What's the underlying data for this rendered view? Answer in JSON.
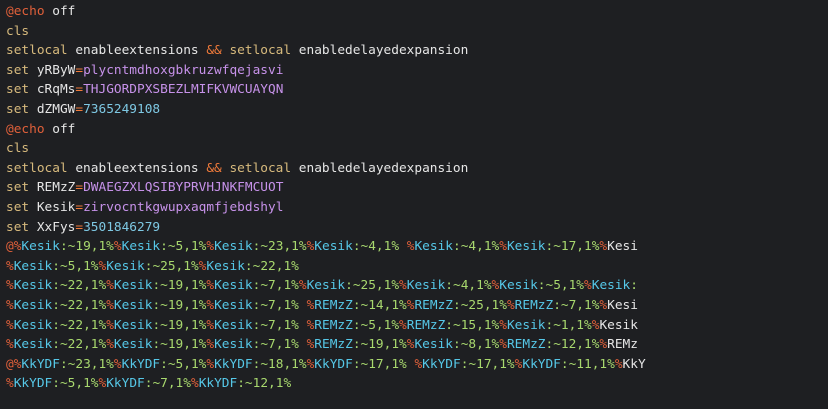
{
  "colors": {
    "background": "#1e1f22",
    "at": "#e0603a",
    "keyword": "#c8c8c8",
    "command": "#d7ba7d",
    "plain": "#e6e6e6",
    "operator": "#f07a3a",
    "value": "#c792ea",
    "string": "#a5d36e",
    "number": "#7ec8e3",
    "percent": "#e0603a",
    "varname": "#56c8e8",
    "substr": "#a8d86e"
  },
  "lines": [
    [
      {
        "t": "@echo",
        "c": "at"
      },
      {
        "t": " off",
        "c": "plain"
      }
    ],
    [
      {
        "t": "cls",
        "c": "command"
      }
    ],
    [
      {
        "t": "setlocal",
        "c": "command"
      },
      {
        "t": " enableextensions ",
        "c": "plain"
      },
      {
        "t": "&&",
        "c": "operator"
      },
      {
        "t": " setlocal",
        "c": "command"
      },
      {
        "t": " enabledelayedexpansion",
        "c": "plain"
      }
    ],
    [
      {
        "t": "set",
        "c": "command"
      },
      {
        "t": " yRByW",
        "c": "plain"
      },
      {
        "t": "=",
        "c": "operator"
      },
      {
        "t": "plycntmdhoxgbkruzwfqejasvi",
        "c": "value"
      }
    ],
    [
      {
        "t": "set",
        "c": "command"
      },
      {
        "t": " cRqMs",
        "c": "plain"
      },
      {
        "t": "=",
        "c": "operator"
      },
      {
        "t": "THJGORDPXSBEZLMIFKVWCUAYQN",
        "c": "value"
      }
    ],
    [
      {
        "t": "set",
        "c": "command"
      },
      {
        "t": " dZMGW",
        "c": "plain"
      },
      {
        "t": "=",
        "c": "operator"
      },
      {
        "t": "7365249108",
        "c": "number"
      }
    ],
    [
      {
        "t": "@echo",
        "c": "at"
      },
      {
        "t": " off",
        "c": "plain"
      }
    ],
    [
      {
        "t": "cls",
        "c": "command"
      }
    ],
    [
      {
        "t": "setlocal",
        "c": "command"
      },
      {
        "t": " enableextensions ",
        "c": "plain"
      },
      {
        "t": "&&",
        "c": "operator"
      },
      {
        "t": " setlocal",
        "c": "command"
      },
      {
        "t": " enabledelayedexpansion",
        "c": "plain"
      }
    ],
    [
      {
        "t": "set",
        "c": "command"
      },
      {
        "t": " REMzZ",
        "c": "plain"
      },
      {
        "t": "=",
        "c": "operator"
      },
      {
        "t": "DWAEGZXLQSIBYPRVHJNKFMCUOT",
        "c": "value"
      }
    ],
    [
      {
        "t": "set",
        "c": "command"
      },
      {
        "t": " Kesik",
        "c": "plain"
      },
      {
        "t": "=",
        "c": "operator"
      },
      {
        "t": "zirvocntkgwupxaqmfjebdshyl",
        "c": "value"
      }
    ],
    [
      {
        "t": "set",
        "c": "command"
      },
      {
        "t": " XxFys",
        "c": "plain"
      },
      {
        "t": "=",
        "c": "operator"
      },
      {
        "t": "3501846279",
        "c": "number"
      }
    ],
    [
      {
        "t": "@%",
        "c": "percent"
      },
      {
        "t": "Kesik:~19,1%",
        "c": "plain"
      },
      {
        "t": "%",
        "c": "percent"
      },
      {
        "t": "Kesik:~5,1%",
        "c": "plain"
      },
      {
        "t": "%",
        "c": "percent"
      },
      {
        "t": "Kesik:~23,1%",
        "c": "plain"
      },
      {
        "t": "%",
        "c": "percent"
      },
      {
        "t": "Kesik:~4,1%",
        "c": "plain"
      },
      {
        "t": " %",
        "c": "percent"
      },
      {
        "t": "Kesik:~4,1%",
        "c": "plain"
      },
      {
        "t": "%",
        "c": "percent"
      },
      {
        "t": "Kesik:~17,1%",
        "c": "plain"
      },
      {
        "t": "%",
        "c": "percent"
      },
      {
        "t": "Kesi",
        "c": "plain"
      }
    ],
    [
      {
        "t": "%",
        "c": "percent"
      },
      {
        "t": "Kesik:~5,1%",
        "c": "plain"
      },
      {
        "t": "%",
        "c": "percent"
      },
      {
        "t": "Kesik:~25,1%",
        "c": "plain"
      },
      {
        "t": "%",
        "c": "percent"
      },
      {
        "t": "Kesik:~22,1%",
        "c": "plain"
      }
    ],
    [
      {
        "t": "%",
        "c": "percent"
      },
      {
        "t": "Kesik:~22,1%",
        "c": "plain"
      },
      {
        "t": "%",
        "c": "percent"
      },
      {
        "t": "Kesik:~19,1%",
        "c": "plain"
      },
      {
        "t": "%",
        "c": "percent"
      },
      {
        "t": "Kesik:~7,1%",
        "c": "plain"
      },
      {
        "t": "%",
        "c": "percent"
      },
      {
        "t": "Kesik:~25,1%",
        "c": "plain"
      },
      {
        "t": "%",
        "c": "percent"
      },
      {
        "t": "Kesik:~4,1%",
        "c": "plain"
      },
      {
        "t": "%",
        "c": "percent"
      },
      {
        "t": "Kesik:~5,1%",
        "c": "plain"
      },
      {
        "t": "%",
        "c": "percent"
      },
      {
        "t": "Kesik:",
        "c": "plain"
      }
    ],
    [
      {
        "t": "%",
        "c": "percent"
      },
      {
        "t": "Kesik:~22,1%",
        "c": "plain"
      },
      {
        "t": "%",
        "c": "percent"
      },
      {
        "t": "Kesik:~19,1%",
        "c": "plain"
      },
      {
        "t": "%",
        "c": "percent"
      },
      {
        "t": "Kesik:~7,1%",
        "c": "plain"
      },
      {
        "t": " %",
        "c": "percent"
      },
      {
        "t": "REMzZ:~14,1%",
        "c": "plain"
      },
      {
        "t": "%",
        "c": "percent"
      },
      {
        "t": "REMzZ:~25,1%",
        "c": "plain"
      },
      {
        "t": "%",
        "c": "percent"
      },
      {
        "t": "REMzZ:~7,1%",
        "c": "plain"
      },
      {
        "t": "%",
        "c": "percent"
      },
      {
        "t": "Kesi",
        "c": "plain"
      }
    ],
    [
      {
        "t": "%",
        "c": "percent"
      },
      {
        "t": "Kesik:~22,1%",
        "c": "plain"
      },
      {
        "t": "%",
        "c": "percent"
      },
      {
        "t": "Kesik:~19,1%",
        "c": "plain"
      },
      {
        "t": "%",
        "c": "percent"
      },
      {
        "t": "Kesik:~7,1%",
        "c": "plain"
      },
      {
        "t": " %",
        "c": "percent"
      },
      {
        "t": "REMzZ:~5,1%",
        "c": "plain"
      },
      {
        "t": "%",
        "c": "percent"
      },
      {
        "t": "REMzZ:~15,1%",
        "c": "plain"
      },
      {
        "t": "%",
        "c": "percent"
      },
      {
        "t": "Kesik:~1,1%",
        "c": "plain"
      },
      {
        "t": "%",
        "c": "percent"
      },
      {
        "t": "Kesik",
        "c": "plain"
      }
    ],
    [
      {
        "t": "%",
        "c": "percent"
      },
      {
        "t": "Kesik:~22,1%",
        "c": "plain"
      },
      {
        "t": "%",
        "c": "percent"
      },
      {
        "t": "Kesik:~19,1%",
        "c": "plain"
      },
      {
        "t": "%",
        "c": "percent"
      },
      {
        "t": "Kesik:~7,1%",
        "c": "plain"
      },
      {
        "t": " %",
        "c": "percent"
      },
      {
        "t": "REMzZ:~19,1%",
        "c": "plain"
      },
      {
        "t": "%",
        "c": "percent"
      },
      {
        "t": "Kesik:~8,1%",
        "c": "plain"
      },
      {
        "t": "%",
        "c": "percent"
      },
      {
        "t": "REMzZ:~12,1%",
        "c": "plain"
      },
      {
        "t": "%",
        "c": "percent"
      },
      {
        "t": "REMz",
        "c": "plain"
      }
    ],
    [
      {
        "t": "@%",
        "c": "percent"
      },
      {
        "t": "KkYDF:~23,1%",
        "c": "plain"
      },
      {
        "t": "%",
        "c": "percent"
      },
      {
        "t": "KkYDF:~5,1%",
        "c": "plain"
      },
      {
        "t": "%",
        "c": "percent"
      },
      {
        "t": "KkYDF:~18,1%",
        "c": "plain"
      },
      {
        "t": "%",
        "c": "percent"
      },
      {
        "t": "KkYDF:~17,1%",
        "c": "plain"
      },
      {
        "t": " %",
        "c": "percent"
      },
      {
        "t": "KkYDF:~17,1%",
        "c": "plain"
      },
      {
        "t": "%",
        "c": "percent"
      },
      {
        "t": "KkYDF:~11,1%",
        "c": "plain"
      },
      {
        "t": "%",
        "c": "percent"
      },
      {
        "t": "KkY",
        "c": "plain"
      }
    ],
    [
      {
        "t": "%",
        "c": "percent"
      },
      {
        "t": "KkYDF:~5,1%",
        "c": "plain"
      },
      {
        "t": "%",
        "c": "percent"
      },
      {
        "t": "KkYDF:~7,1%",
        "c": "plain"
      },
      {
        "t": "%",
        "c": "percent"
      },
      {
        "t": "KkYDF:~12,1%",
        "c": "plain"
      }
    ]
  ]
}
